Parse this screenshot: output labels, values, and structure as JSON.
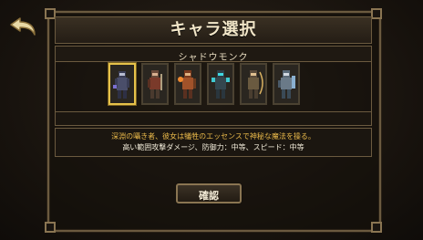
{
  "screen": {
    "title": "キャラ選択",
    "selected_character_name": "シャドウモンク",
    "description_line1": "深淵の囁き者、彼女は犠牲のエッセンスで神秘な魔法を操る。",
    "description_line2": "高い範囲攻撃ダメージ、防御力：中等、スピード：中等",
    "confirm_label": "確認"
  },
  "characters": [
    {
      "slot": 1,
      "selected": true,
      "accent": "#5a5f7a"
    },
    {
      "slot": 2,
      "selected": false,
      "accent": "#8a3a2a"
    },
    {
      "slot": 3,
      "selected": false,
      "accent": "#c87a3a"
    },
    {
      "slot": 4,
      "selected": false,
      "accent": "#3aa6b0"
    },
    {
      "slot": 5,
      "selected": false,
      "accent": "#c8a050"
    },
    {
      "slot": 6,
      "selected": false,
      "accent": "#6a9ac0"
    }
  ],
  "colors": {
    "frame": "#6b5a3f",
    "selected_border": "#e6c24a",
    "description_highlight": "#e8b84a"
  },
  "icons": {
    "back": "back-arrow-icon"
  }
}
